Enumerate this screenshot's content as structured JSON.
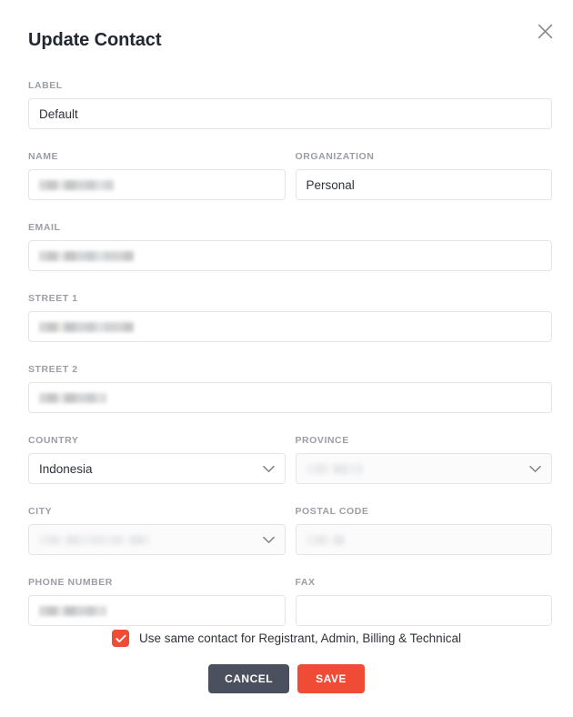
{
  "modal": {
    "title": "Update Contact",
    "close_icon": "close-icon"
  },
  "colors": {
    "accent": "#f04b35",
    "cancel": "#4b505f",
    "label": "#9c9ea5",
    "border": "#e2e4e8",
    "text": "#2e3239"
  },
  "fields": {
    "label": {
      "label": "LABEL",
      "value": "Default",
      "redacted": false
    },
    "name": {
      "label": "NAME",
      "value": "",
      "redacted": true
    },
    "organization": {
      "label": "ORGANIZATION",
      "value": "Personal",
      "redacted": false
    },
    "email": {
      "label": "EMAIL",
      "value": "",
      "redacted": true
    },
    "street1": {
      "label": "STREET 1",
      "value": "",
      "redacted": true
    },
    "street2": {
      "label": "STREET 2",
      "value": "",
      "redacted": true
    },
    "country": {
      "label": "COUNTRY",
      "value": "Indonesia",
      "redacted": false,
      "type": "select"
    },
    "province": {
      "label": "PROVINCE",
      "value": "",
      "redacted": true,
      "type": "select"
    },
    "city": {
      "label": "CITY",
      "value": "",
      "redacted": true,
      "type": "select"
    },
    "postal_code": {
      "label": "POSTAL CODE",
      "value": "",
      "redacted": true
    },
    "phone_number": {
      "label": "PHONE NUMBER",
      "value": "",
      "redacted": true
    },
    "fax": {
      "label": "FAX",
      "value": "",
      "redacted": false
    }
  },
  "checkbox": {
    "label": "Use same contact for Registrant, Admin, Billing & Technical",
    "checked": true
  },
  "buttons": {
    "cancel": "CANCEL",
    "save": "SAVE"
  }
}
